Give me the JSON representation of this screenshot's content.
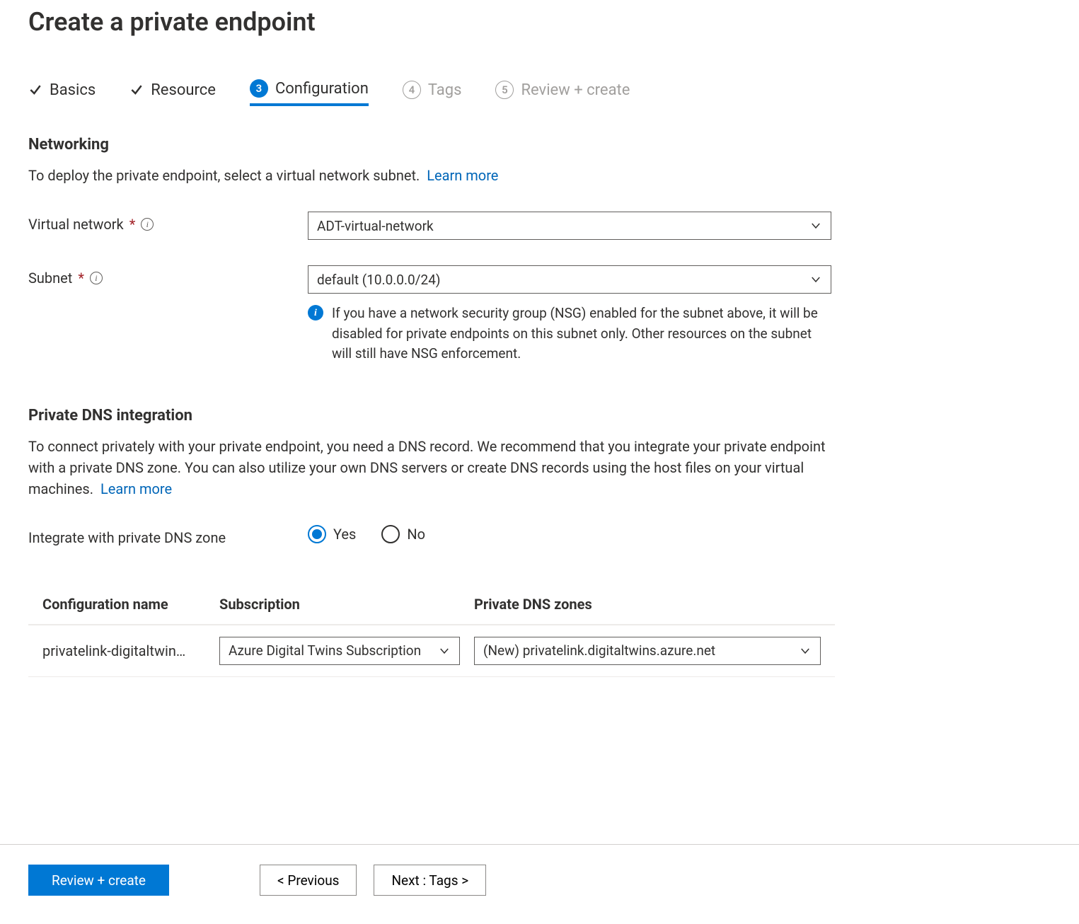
{
  "title": "Create a private endpoint",
  "tabs": {
    "basics": {
      "label": "Basics"
    },
    "resource": {
      "label": "Resource"
    },
    "config": {
      "num": "3",
      "label": "Configuration"
    },
    "tags": {
      "num": "4",
      "label": "Tags"
    },
    "review": {
      "num": "5",
      "label": "Review + create"
    }
  },
  "networking": {
    "heading": "Networking",
    "description": "To deploy the private endpoint, select a virtual network subnet.",
    "learn_more": "Learn more",
    "vnet_label": "Virtual network",
    "vnet_value": "ADT-virtual-network",
    "subnet_label": "Subnet",
    "subnet_value": "default (10.0.0.0/24)",
    "subnet_note": "If you have a network security group (NSG) enabled for the subnet above, it will be disabled for private endpoints on this subnet only. Other resources on the subnet will still have NSG enforcement."
  },
  "dns": {
    "heading": "Private DNS integration",
    "description": "To connect privately with your private endpoint, you need a DNS record. We recommend that you integrate your private endpoint with a private DNS zone. You can also utilize your own DNS servers or create DNS records using the host files on your virtual machines.",
    "learn_more": "Learn more",
    "integrate_label": "Integrate with private DNS zone",
    "radio_yes": "Yes",
    "radio_no": "No",
    "table": {
      "head_config": "Configuration name",
      "head_sub": "Subscription",
      "head_zone": "Private DNS zones",
      "row0": {
        "config": "privatelink-digitaltwin…",
        "sub": "Azure Digital Twins Subscription",
        "zone": "(New) privatelink.digitaltwins.azure.net"
      }
    }
  },
  "footer": {
    "review": "Review + create",
    "previous": "< Previous",
    "next": "Next : Tags >"
  }
}
